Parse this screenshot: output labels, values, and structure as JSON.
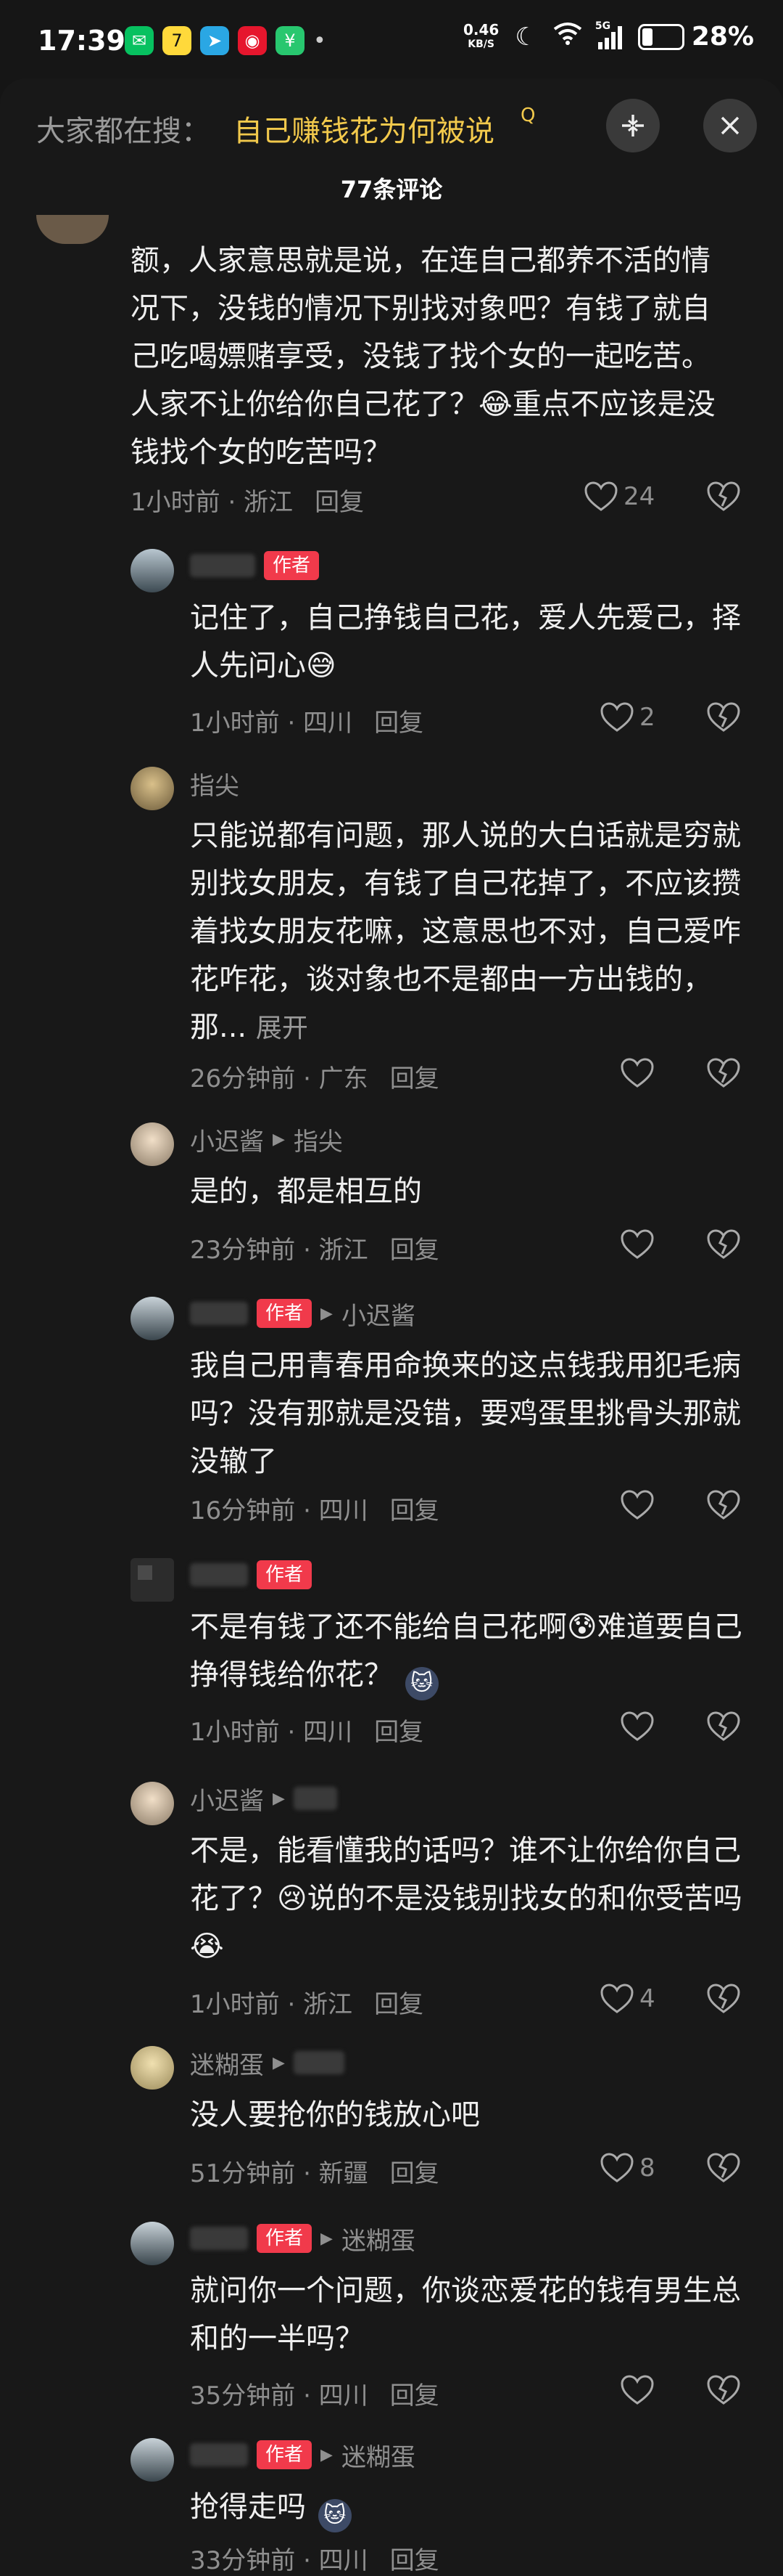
{
  "status_bar": {
    "time": "17:39",
    "speed_value": "0.46",
    "speed_unit": "KB/S",
    "battery": "28%",
    "network": "5G"
  },
  "search": {
    "prefix": "大家都在搜：",
    "query": "自己赚钱花为何被说",
    "query_icon": "Q"
  },
  "comment_count_title": "77条评论",
  "comments": [
    {
      "text": "额，人家意思就是说，在连自己都养不活的情况下，没钱的情况下别找对象吧？有钱了就自己吃喝嫖赌享受，没钱了找个女的一起吃苦。人家不让你给你自己花了？😂重点不应该是没钱找个女的吃苦吗？",
      "time": "1小时前 · 浙江",
      "reply": "回复",
      "likes": "24"
    },
    {
      "badge": "作者",
      "text": "记住了，自己挣钱自己花，爱人先爱己，择人先问心😅",
      "time": "1小时前 · 四川",
      "reply": "回复",
      "likes": "2"
    },
    {
      "name": "指尖",
      "text": "只能说都有问题，那人说的大白话就是穷就别找女朋友，有钱了自己花掉了，不应该攒着找女朋友花嘛，这意思也不对，自己爱咋花咋花，谈对象也不是都由一方出钱的，那...",
      "expand": "展开",
      "time": "26分钟前 · 广东",
      "reply": "回复"
    },
    {
      "name": "小迟酱",
      "reply_to": "指尖",
      "text": "是的，都是相互的",
      "time": "23分钟前 · 浙江",
      "reply": "回复"
    },
    {
      "badge": "作者",
      "reply_to": "小迟酱",
      "text": "我自己用青春用命换来的这点钱我用犯毛病吗？没有那就是没错，要鸡蛋里挑骨头那就没辙了",
      "time": "16分钟前 · 四川",
      "reply": "回复"
    },
    {
      "badge": "作者",
      "text": "不是有钱了还不能给自己花啊😰难道要自己挣得钱给你花？",
      "time": "1小时前 · 四川",
      "reply": "回复"
    },
    {
      "name": "小迟酱",
      "text": "不是，能看懂我的话吗？谁不让你给你自己花了？😢说的不是没钱别找女的和你受苦吗😭",
      "time": "1小时前 · 浙江",
      "reply": "回复",
      "likes": "4"
    },
    {
      "name": "迷糊蛋",
      "text": "没人要抢你的钱放心吧",
      "time": "51分钟前 · 新疆",
      "reply": "回复",
      "likes": "8"
    },
    {
      "badge": "作者",
      "reply_to": "迷糊蛋",
      "text": "就问你一个问题，你谈恋爱花的钱有男生总和的一半吗？",
      "time": "35分钟前 · 四川",
      "reply": "回复"
    },
    {
      "badge": "作者",
      "reply_to": "迷糊蛋",
      "text": "抢得走吗",
      "time": "33分钟前 · 四川",
      "reply": "回复"
    }
  ],
  "colors": {
    "background": "#151515",
    "author_badge": "#f13a4b",
    "search_highlight": "#f2c94c",
    "meta_text": "#8f8f8f"
  },
  "icons": [
    "heart-icon",
    "broken-heart-icon",
    "close-icon",
    "shrink-icon",
    "reply-arrow-icon"
  ]
}
